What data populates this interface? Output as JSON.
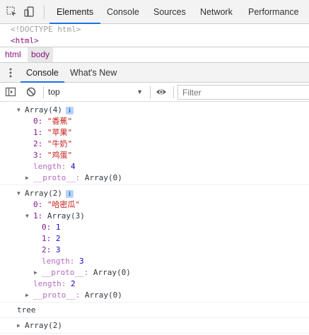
{
  "devtools_tabs": {
    "inspect_icon": "inspect-element-icon",
    "device_icon": "device-toolbar-icon",
    "items": [
      "Elements",
      "Console",
      "Sources",
      "Network",
      "Performance"
    ],
    "active": "Elements"
  },
  "elements": {
    "doctype": "<!DOCTYPE html>",
    "html_tag": "<html>"
  },
  "breadcrumbs": [
    "html",
    "body"
  ],
  "drawer": {
    "menu_icon": "kebab-menu-icon",
    "tabs": [
      "Console",
      "What's New"
    ],
    "active": "Console"
  },
  "console_toolbar": {
    "sidebar_icon": "show-sidebar-icon",
    "clear_icon": "clear-console-icon",
    "context": "top",
    "eye_icon": "live-expression-eye-icon",
    "filter_placeholder": "Filter"
  },
  "console": {
    "array1": {
      "header": "Array(4)",
      "info": "i",
      "items": [
        {
          "key": "0:",
          "value": "\"香蕉\""
        },
        {
          "key": "1:",
          "value": "\"苹果\""
        },
        {
          "key": "2:",
          "value": "\"牛奶\""
        },
        {
          "key": "3:",
          "value": "\"鸡蛋\""
        }
      ],
      "length_key": "length:",
      "length_value": "4",
      "proto_key": "__proto__:",
      "proto_value": "Array(0)"
    },
    "array2": {
      "header": "Array(2)",
      "info": "i",
      "item0": {
        "key": "0:",
        "value": "\"哈密瓜\""
      },
      "item1": {
        "key": "1:",
        "value": "Array(3)"
      },
      "nested": [
        {
          "key": "0:",
          "value": "1"
        },
        {
          "key": "1:",
          "value": "2"
        },
        {
          "key": "2:",
          "value": "3"
        }
      ],
      "nested_length_key": "length:",
      "nested_length_value": "3",
      "nested_proto_key": "__proto__:",
      "nested_proto_value": "Array(0)",
      "length_key": "length:",
      "length_value": "2",
      "proto_key": "__proto__:",
      "proto_value": "Array(0)"
    },
    "log_text": "tree",
    "collapsed_array": "Array(2)"
  },
  "colors": {
    "accent": "#1a73e8",
    "key": "#881391",
    "string": "#c41a16",
    "number": "#1c00cf",
    "tag": "#881280"
  }
}
